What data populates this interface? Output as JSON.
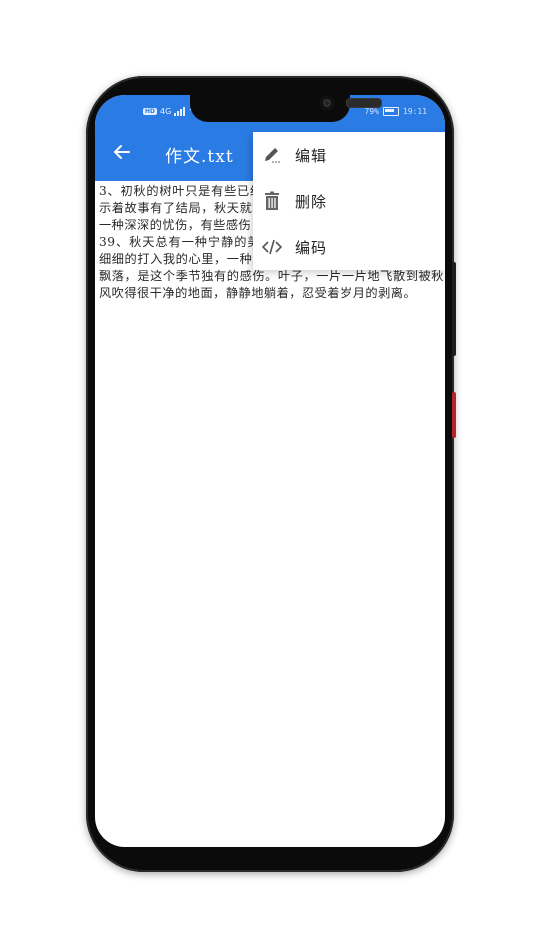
{
  "status_bar": {
    "left_label": "HD",
    "network": "4G",
    "battery": "79%",
    "time": "19:11"
  },
  "app_bar": {
    "back_icon": "arrow-left-icon",
    "title": "作文.txt",
    "color": "#2a7be4"
  },
  "document": {
    "paragraphs": [
      "3、初秋的树叶只是有些已经开始变黄，还没有要飘零，也预示着故事有了结局，秋天就是这个颜色，这声这色，都埋藏着一种深深的忧伤，有些感伤，一点宁静，一点幻想。",
      "39、秋天总有一种宁静的美，让人看了心生欢喜，秋雨总会细细的打入我的心里，一种凉意痛彻全身，眼前看到的凋零和飘落，是这个季节独有的感伤。叶子，一片一片地飞散到被秋风吹得很干净的地面，静静地躺着，忍受着岁月的剥离。"
    ]
  },
  "menu": {
    "items": [
      {
        "icon": "pencil-icon",
        "label": "编辑"
      },
      {
        "icon": "trash-icon",
        "label": "删除"
      },
      {
        "icon": "code-icon",
        "label": "编码"
      }
    ]
  }
}
